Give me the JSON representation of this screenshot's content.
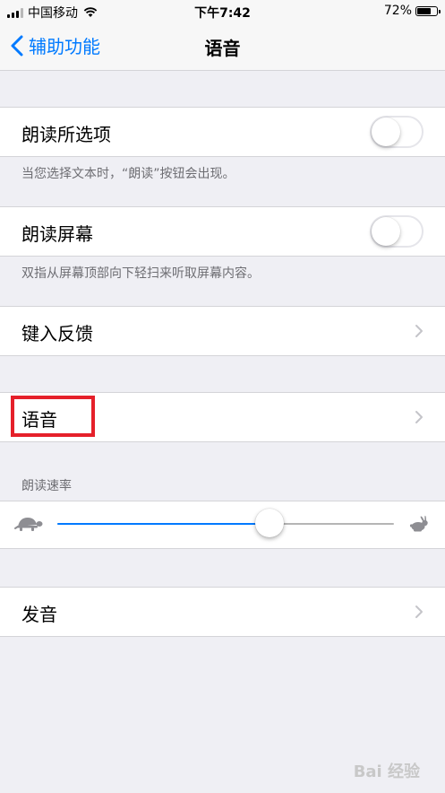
{
  "status_bar": {
    "carrier": "中国移动",
    "time": "下午7:42",
    "battery": "72%",
    "battery_level": 0.72
  },
  "nav": {
    "back_label": "辅助功能",
    "title": "语音"
  },
  "speak_selection": {
    "label": "朗读所选项",
    "enabled": false,
    "footnote": "当您选择文本时，“朗读”按钮会出现。"
  },
  "speak_screen": {
    "label": "朗读屏幕",
    "enabled": false,
    "footnote": "双指从屏幕顶部向下轻扫来听取屏幕内容。"
  },
  "typing_feedback": {
    "label": "键入反馈"
  },
  "voices": {
    "label": "语音"
  },
  "speaking_rate": {
    "header": "朗读速率",
    "value": 0.63,
    "min_icon": "turtle-icon",
    "max_icon": "hare-icon"
  },
  "pronunciations": {
    "label": "发音"
  },
  "watermark": "Bai 经验",
  "colors": {
    "accent": "#007aff",
    "background": "#efeff4",
    "highlight": "#e5202a"
  }
}
